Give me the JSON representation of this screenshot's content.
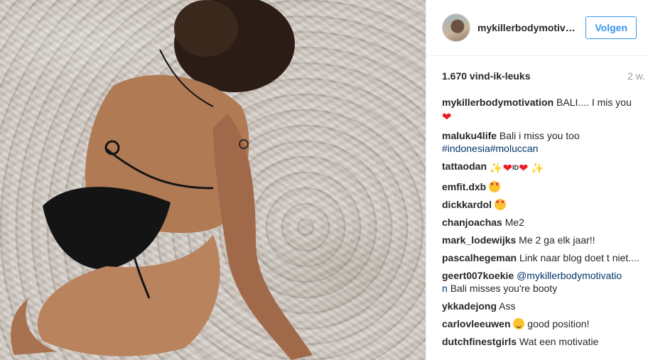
{
  "post": {
    "username": "mykillerbodymotivat...",
    "follow_label": "Volgen",
    "likes": "1.670 vind-ik-leuks",
    "age": "2 w."
  },
  "comments": [
    {
      "user": "mykillerbodymotivation",
      "text": "BALI.... I mis you",
      "emoji_after": [
        "red-heart"
      ]
    },
    {
      "user": "maluku4life",
      "text": "Bali i miss you too",
      "tags": [
        "#indonesia",
        "#moluccan"
      ]
    },
    {
      "user": "tattaodan",
      "emoji": [
        "sparkles",
        "red-heart",
        "id-button",
        "red-heart",
        "sparkles"
      ],
      "id_text": "ID"
    },
    {
      "user": "emfit.dxb",
      "emoji": [
        "heart-eyes-face"
      ]
    },
    {
      "user": "dickkardol",
      "emoji": [
        "heart-eyes-face"
      ]
    },
    {
      "user": "chanjoachas",
      "text": "Me2"
    },
    {
      "user": "mark_lodewijks",
      "text": "Me 2 ga elk jaar!!"
    },
    {
      "user": "pascalhegeman",
      "text": "Link naar blog doet t niet...."
    },
    {
      "user": "geert007koekie",
      "mention": "@mykillerbodymotivatio",
      "mention_rest": "n",
      "text": "Bali misses you're booty"
    },
    {
      "user": "ykkadejong",
      "text": "Ass"
    },
    {
      "user": "carlovleeuwen",
      "text": "good position!",
      "emoji": [
        "smiling-face"
      ]
    },
    {
      "user": "dutchfinestgirls",
      "text": "Wat een motivatie"
    }
  ],
  "colors": {
    "link_blue": "#3897f0",
    "hashtag": "#003569",
    "heart": "#ed1c24"
  }
}
